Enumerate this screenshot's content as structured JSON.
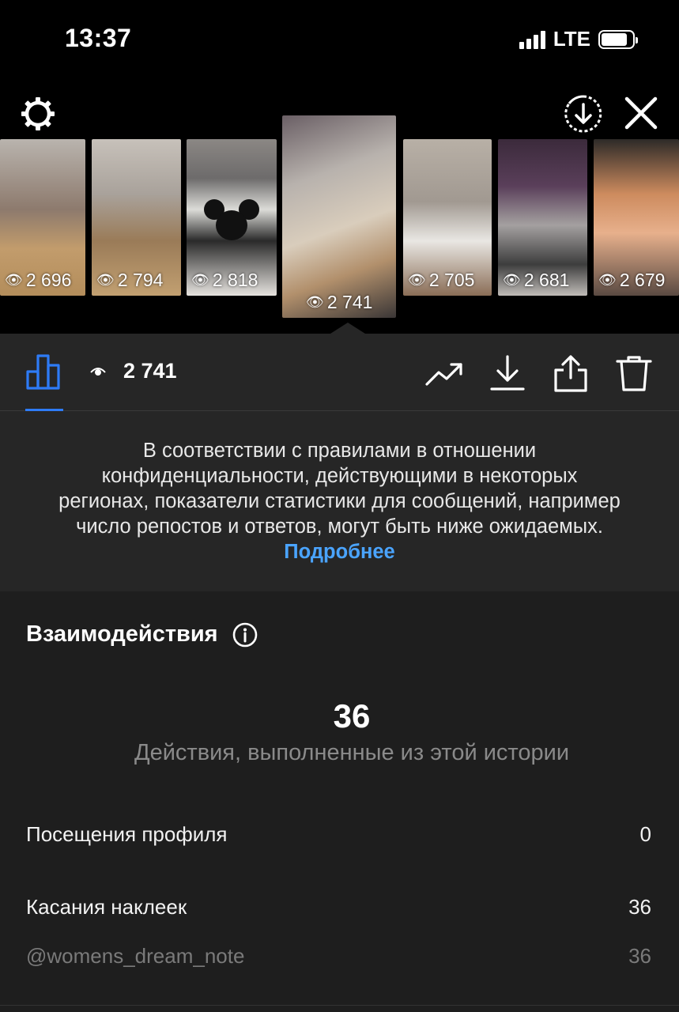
{
  "status_bar": {
    "time": "13:37",
    "network": "LTE",
    "battery_level": 0.85
  },
  "story_strip": {
    "thumbnails": [
      {
        "views": "2 696",
        "selected": false
      },
      {
        "views": "2 794",
        "selected": false
      },
      {
        "views": "2 818",
        "selected": false
      },
      {
        "views": "2 741",
        "selected": true
      },
      {
        "views": "2 705",
        "selected": false
      },
      {
        "views": "2 681",
        "selected": false
      },
      {
        "views": "2 679",
        "selected": false
      }
    ],
    "icons": [
      "gear-icon",
      "download-circle-icon",
      "close-icon"
    ]
  },
  "toolbar": {
    "views_count": "2 741",
    "icons": [
      "bar-chart-icon",
      "eye-icon",
      "trend-up-icon",
      "download-icon",
      "share-icon",
      "trash-icon"
    ],
    "accent_color": "#2e7bf6"
  },
  "notice": {
    "text": "В соответствии с правилами в отношении конфиденциальности, действующими в некоторых регионах, показатели статистики для сообщений, например число репостов и ответов, могут быть ниже ожидаемых.",
    "link_label": "Подробнее",
    "link_color": "#4aa4ff"
  },
  "interactions": {
    "title": "Взаимодействия",
    "total": "36",
    "caption": "Действия, выполненные из этой истории",
    "rows": [
      {
        "label": "Посещения профиля",
        "value": "0"
      },
      {
        "label": "Касания наклеек",
        "value": "36"
      },
      {
        "label": "@womens_dream_note",
        "value": "36"
      }
    ]
  }
}
